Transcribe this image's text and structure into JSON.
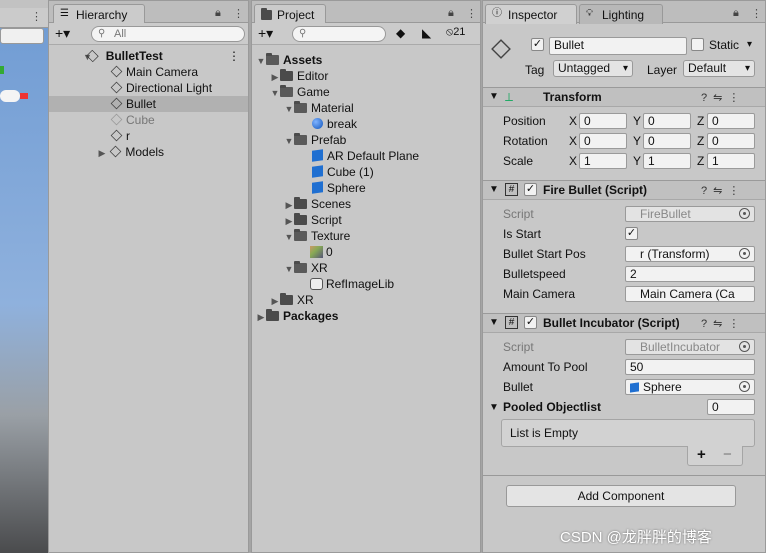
{
  "hierarchy": {
    "tab_label": "Hierarchy",
    "search_placeholder": "All",
    "scene_name": "BulletTest",
    "items": [
      {
        "label": "Main Camera"
      },
      {
        "label": "Directional Light"
      },
      {
        "label": "Bullet"
      },
      {
        "label": "Cube"
      },
      {
        "label": "r"
      },
      {
        "label": "Models"
      }
    ]
  },
  "project": {
    "tab_label": "Project",
    "hidden_count": "21",
    "tree": {
      "assets": "Assets",
      "editor": "Editor",
      "game": "Game",
      "material": "Material",
      "break": "break",
      "prefab": "Prefab",
      "ar_plane": "AR Default Plane",
      "cube1": "Cube (1)",
      "sphere": "Sphere",
      "scenes": "Scenes",
      "script": "Script",
      "texture": "Texture",
      "tex0": "0",
      "xr_inner": "XR",
      "reflib": "RefImageLib",
      "xr": "XR",
      "packages": "Packages"
    }
  },
  "inspector": {
    "tab_label": "Inspector",
    "lighting_label": "Lighting",
    "object_name": "Bullet",
    "static_label": "Static",
    "tag_label": "Tag",
    "tag_value": "Untagged",
    "layer_label": "Layer",
    "layer_value": "Default",
    "transform": {
      "title": "Transform",
      "position_label": "Position",
      "rotation_label": "Rotation",
      "scale_label": "Scale",
      "x": "X",
      "y": "Y",
      "z": "Z",
      "position": [
        "0",
        "0",
        "0"
      ],
      "rotation": [
        "0",
        "0",
        "0"
      ],
      "scale": [
        "1",
        "1",
        "1"
      ]
    },
    "fire_bullet": {
      "title": "Fire Bullet (Script)",
      "script_label": "Script",
      "script_value": "FireBullet",
      "is_start_label": "Is Start",
      "start_pos_label": "Bullet Start Pos",
      "start_pos_value": "r (Transform)",
      "speed_label": "Bulletspeed",
      "speed_value": "2",
      "camera_label": "Main Camera",
      "camera_value": "Main Camera (Ca"
    },
    "incubator": {
      "title": "Bullet Incubator (Script)",
      "script_label": "Script",
      "script_value": "BulletIncubator",
      "amount_label": "Amount To Pool",
      "amount_value": "50",
      "bullet_label": "Bullet",
      "bullet_value": "Sphere",
      "pooled_label": "Pooled Objectlist",
      "pooled_count": "0",
      "empty_text": "List is Empty",
      "plus": "+",
      "minus": "−"
    },
    "add_component": "Add Component"
  },
  "watermark": "CSDN @龙胖胖的博客"
}
